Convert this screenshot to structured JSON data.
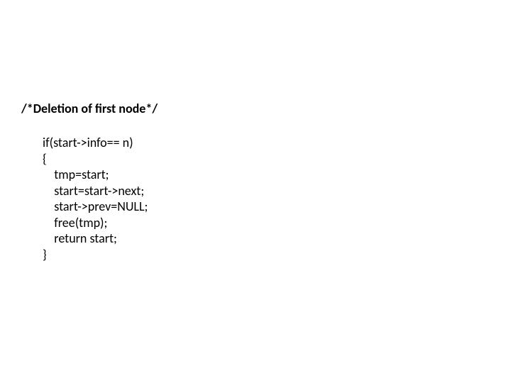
{
  "heading": "/*Deletion of first node*/",
  "code": "if(start->info== n)\n{\n    tmp=start;\n    start=start->next;\n    start->prev=NULL;\n    free(tmp);\n    return start;\n}"
}
